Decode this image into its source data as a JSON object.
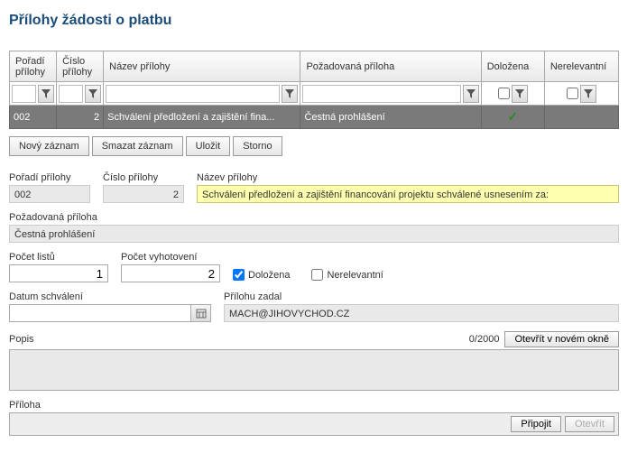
{
  "title": "Přílohy žádosti o platbu",
  "table": {
    "headers": {
      "poradi": "Pořadí přílohy",
      "cislo": "Číslo přílohy",
      "nazev": "Název přílohy",
      "pozadovana": "Požadovaná příloha",
      "dolozena": "Doložena",
      "nerelevantni": "Nerelevantní"
    },
    "row": {
      "poradi": "002",
      "cislo": "2",
      "nazev": "Schválení předložení a zajištění fina...",
      "pozadovana": "Čestná prohlášení",
      "dolozena_checked": "✓",
      "nerelevantni_checked": ""
    }
  },
  "buttons": {
    "novy": "Nový záznam",
    "smazat": "Smazat záznam",
    "ulozit": "Uložit",
    "storno": "Storno",
    "otevrit_okno": "Otevřít v novém okně",
    "pripojit": "Připojit",
    "otevrit": "Otevřít"
  },
  "form": {
    "poradi_lbl": "Pořadí přílohy",
    "poradi_val": "002",
    "cislo_lbl": "Číslo přílohy",
    "cislo_val": "2",
    "nazev_lbl": "Název přílohy",
    "nazev_val": "Schválení předložení a zajištění financování projektu schválené usnesením za:",
    "pozadovana_lbl": "Požadovaná příloha",
    "pozadovana_val": "Čestná prohlášení",
    "pocet_listu_lbl": "Počet listů",
    "pocet_listu_val": "1",
    "pocet_vyhot_lbl": "Počet vyhotovení",
    "pocet_vyhot_val": "2",
    "dolozena_lbl": "Doložena",
    "nerelevantni_lbl": "Nerelevantní",
    "datum_lbl": "Datum schválení",
    "datum_val": "",
    "zadal_lbl": "Přílohu zadal",
    "zadal_val": "MACH@JIHOVYCHOD.CZ",
    "popis_lbl": "Popis",
    "popis_counter": "0/2000",
    "priloha_lbl": "Příloha"
  }
}
